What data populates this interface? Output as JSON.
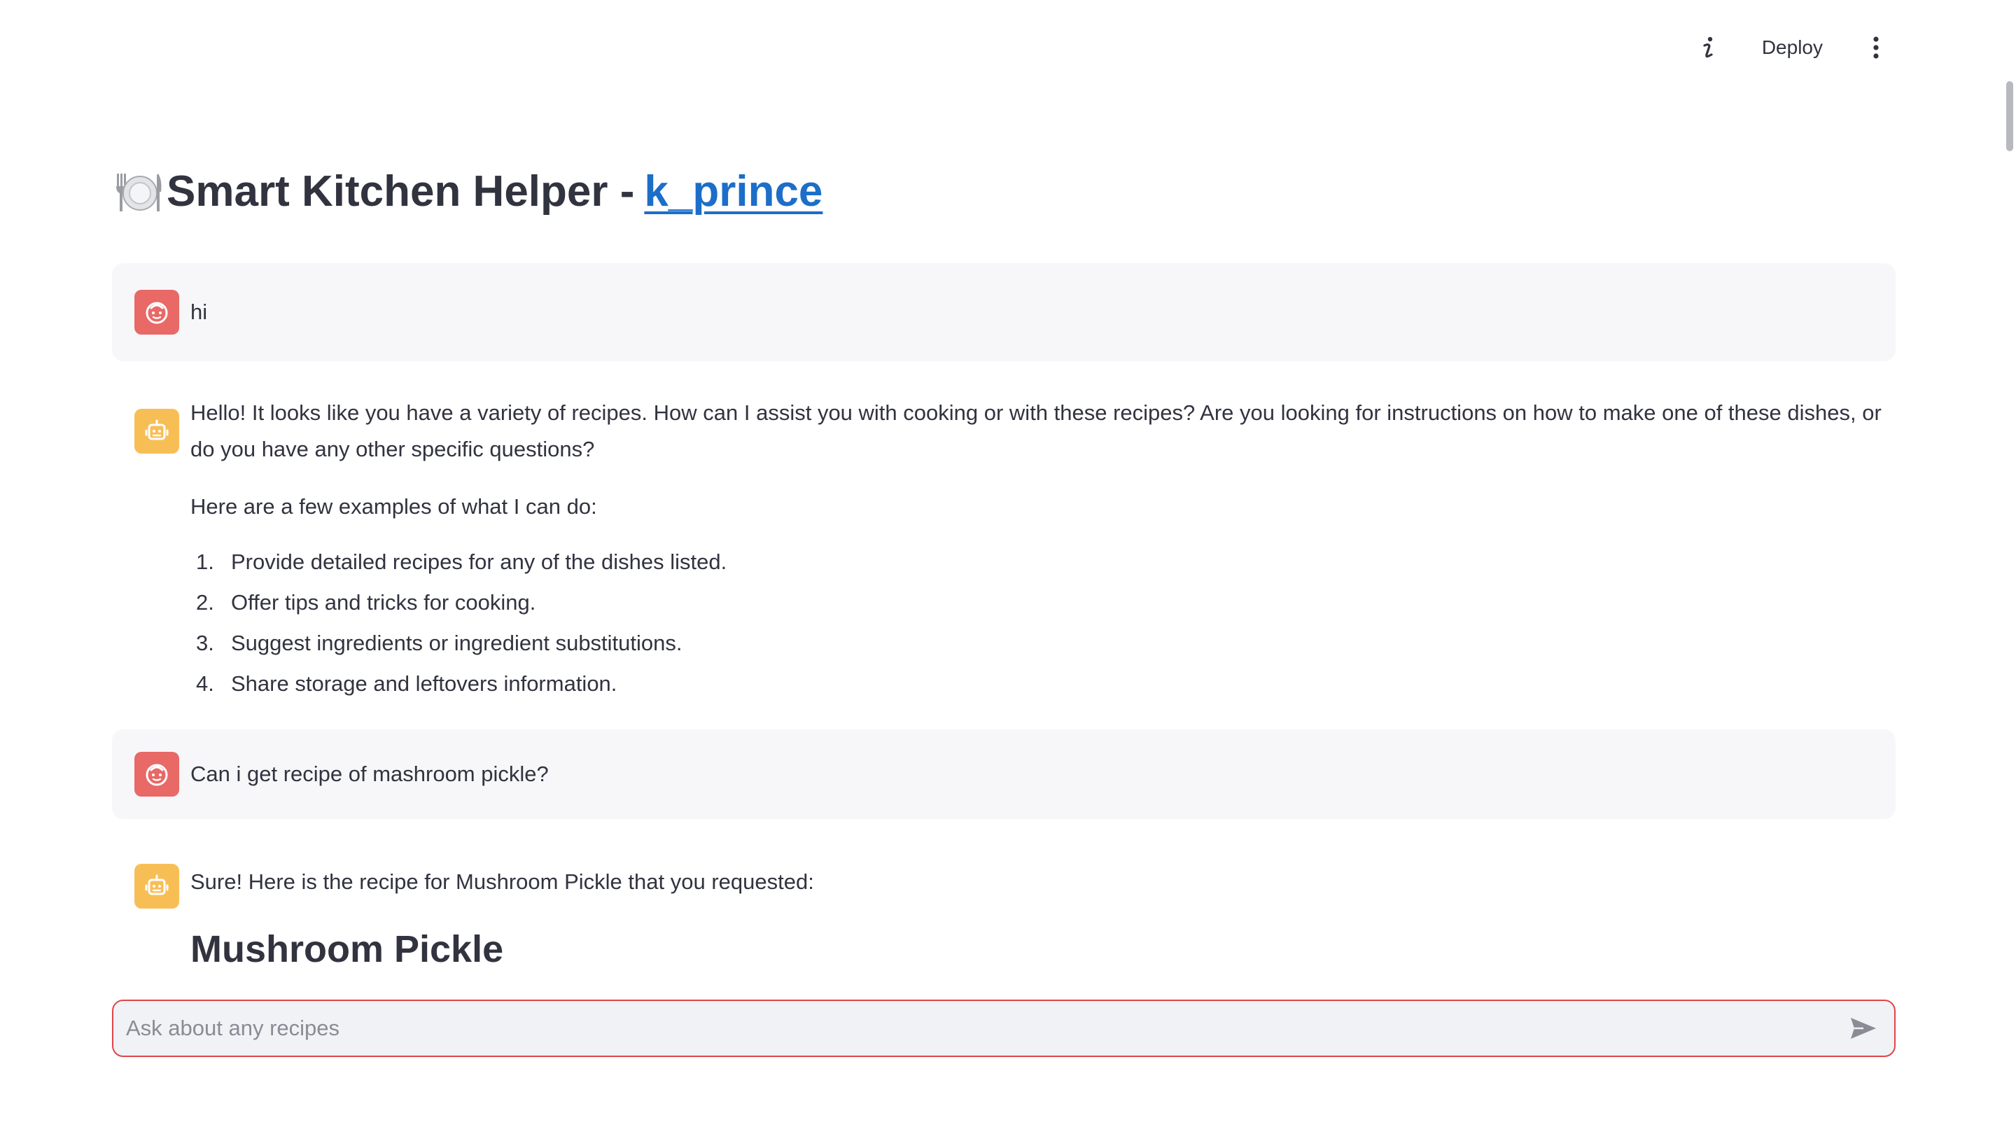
{
  "toolbar": {
    "info_icon": "info-icon",
    "deploy_label": "Deploy",
    "menu_icon": "vertical-dots-menu-icon"
  },
  "title": {
    "emoji_icon": "plate-with-cutlery-icon",
    "text": "Smart Kitchen Helper -",
    "link_text": "k_prince",
    "link_color": "#1c6ec9"
  },
  "messages": [
    {
      "role": "user",
      "avatar_icon": "user-face-icon",
      "text": "hi"
    },
    {
      "role": "assistant",
      "avatar_icon": "robot-icon",
      "intro": "Hello! It looks like you have a variety of recipes. How can I assist you with cooking or with these recipes? Are you looking for instructions on how to make one of these dishes, or do you have any other specific questions?",
      "lead": "Here are a few examples of what I can do:",
      "items": [
        {
          "num": "1.",
          "text": "Provide detailed recipes for any of the dishes listed."
        },
        {
          "num": "2.",
          "text": "Offer tips and tricks for cooking."
        },
        {
          "num": "3.",
          "text": "Suggest ingredients or ingredient substitutions."
        },
        {
          "num": "4.",
          "text": "Share storage and leftovers information."
        }
      ]
    },
    {
      "role": "user",
      "avatar_icon": "user-face-icon",
      "text": "Can i get recipe of mashroom pickle?"
    },
    {
      "role": "assistant",
      "avatar_icon": "robot-icon",
      "text": "Sure! Here is the recipe for Mushroom Pickle that you requested:",
      "heading": "Mushroom Pickle"
    }
  ],
  "chat_input": {
    "placeholder": "Ask about any recipes",
    "value": "",
    "send_icon": "send-arrow-icon"
  },
  "colors": {
    "user_avatar": "#e86966",
    "assistant_avatar": "#f8be56",
    "input_border": "#e0454a",
    "user_bubble": "#f7f7f9"
  }
}
